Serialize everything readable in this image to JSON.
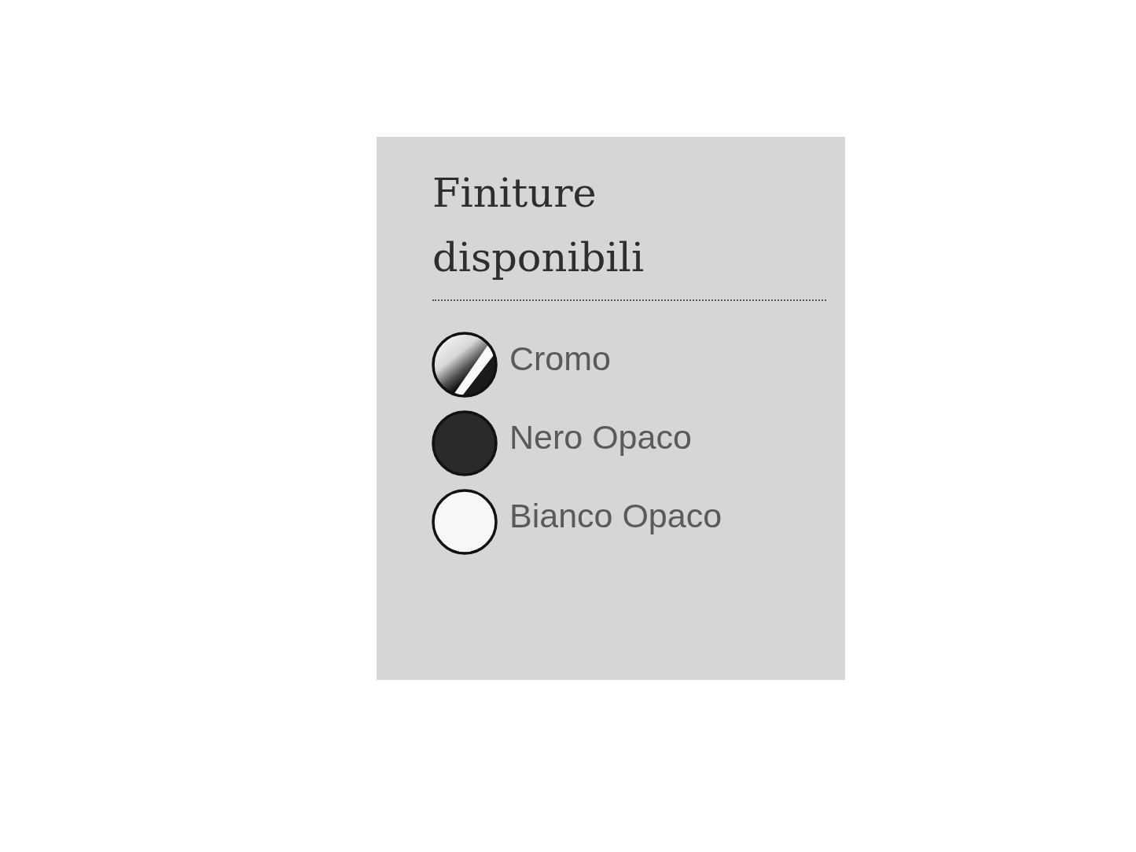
{
  "panel": {
    "title": "Finiture disponibili",
    "finishes": [
      {
        "label": "Cromo",
        "kind": "chrome"
      },
      {
        "label": "Nero Opaco",
        "kind": "matte",
        "color": "#2a2a2a"
      },
      {
        "label": "Bianco Opaco",
        "kind": "matte",
        "color": "#f7f7f5"
      }
    ]
  }
}
